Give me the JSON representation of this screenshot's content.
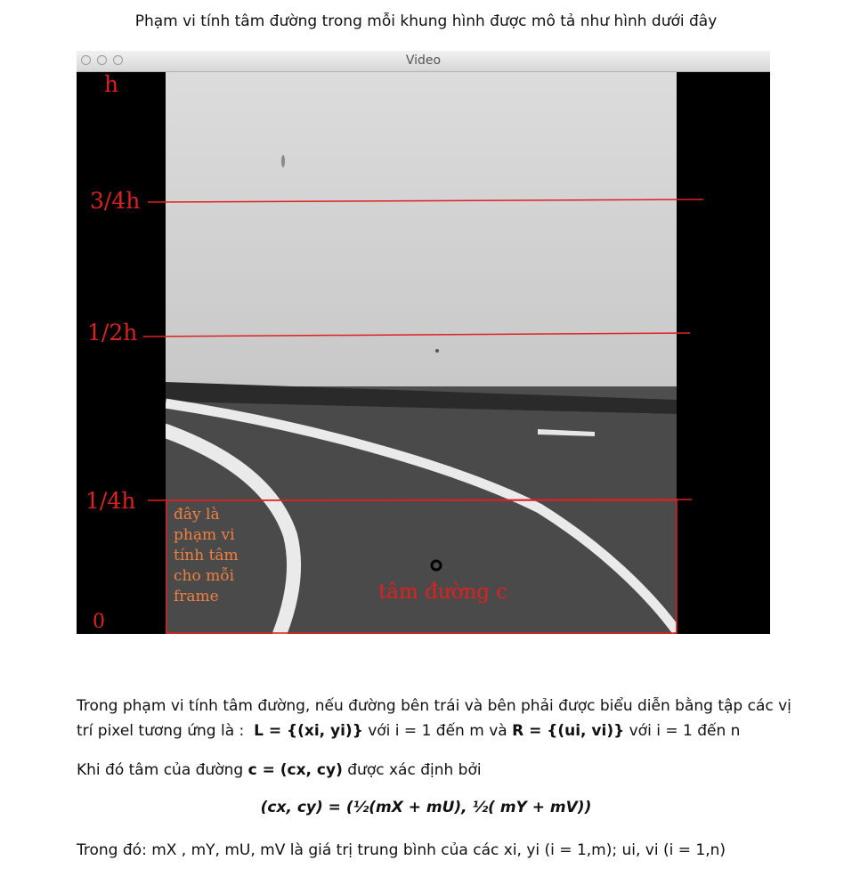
{
  "heading": "Phạm vi tính tâm đường trong mỗi khung hình được mô tả như hình dưới đây",
  "window": {
    "title": "Video"
  },
  "markers": {
    "h": "h",
    "three_quarter": "3/4h",
    "half": "1/2h",
    "quarter": "1/4h",
    "zero": "0"
  },
  "roi_note": [
    "đây là",
    "phạm vi",
    "tính tâm",
    "cho mỗi",
    "frame"
  ],
  "center_label": "tâm đường c",
  "colors": {
    "marker_red": "#e02020",
    "note_orange": "#f08040"
  },
  "text": {
    "p1_line1": "Trong phạm vi tính tâm đường, nếu đường bên trái và bên phải được biểu diễn bằng tập các vị",
    "p1_line2_a": "trí pixel tương ứng là :",
    "p1_L": "L = {(xi, yi)}",
    "p1_line2_b": "với i = 1 đến m  và",
    "p1_R": "R =  {(ui, vi)}",
    "p1_line2_c": "với i = 1 đến n",
    "p2_a": "Khi đó tâm của đường",
    "p2_c": "c = (cx, cy)",
    "p2_b": "được xác định bởi",
    "formula": "(cx, cy) = (½(mX + mU), ½( mY + mV))",
    "p3": "Trong đó: mX , mY, mU, mV là giá trị trung bình của các xi, yi (i = 1,m); ui, vi (i = 1,n)"
  }
}
